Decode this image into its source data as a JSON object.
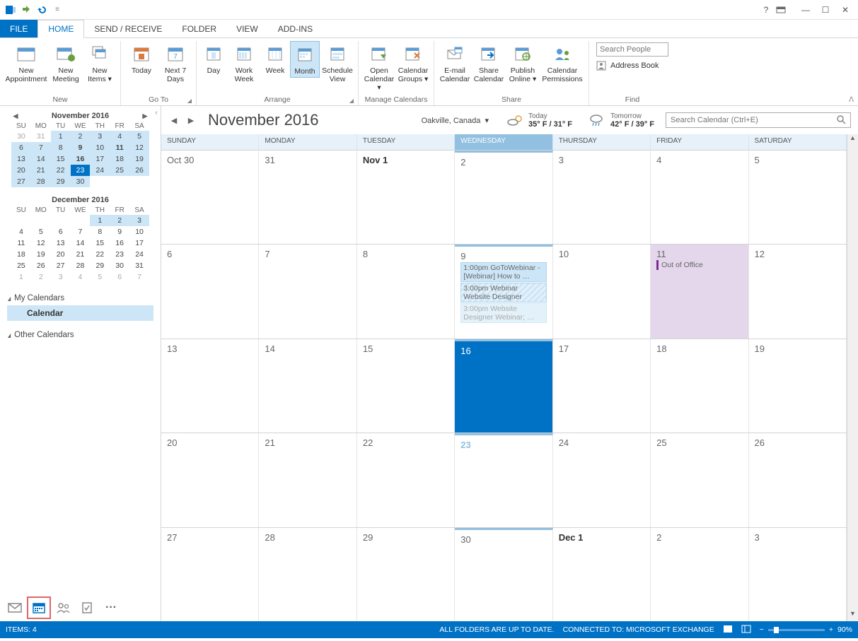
{
  "tabs": {
    "file": "FILE",
    "home": "HOME",
    "sendreceive": "SEND / RECEIVE",
    "folder": "FOLDER",
    "view": "VIEW",
    "addins": "ADD-INS"
  },
  "ribbon": {
    "new_appointment": "New\nAppointment",
    "new_meeting": "New\nMeeting",
    "new_items": "New\nItems ▾",
    "today": "Today",
    "next7": "Next 7\nDays",
    "day": "Day",
    "work_week": "Work\nWeek",
    "week": "Week",
    "month": "Month",
    "schedule_view": "Schedule\nView",
    "open_calendar": "Open\nCalendar ▾",
    "calendar_groups": "Calendar\nGroups ▾",
    "email_calendar": "E-mail\nCalendar",
    "share_calendar": "Share\nCalendar",
    "publish_online": "Publish\nOnline ▾",
    "calendar_permissions": "Calendar\nPermissions",
    "search_people_ph": "Search People",
    "address_book": "Address Book",
    "grp_new": "New",
    "grp_goto": "Go To",
    "grp_arrange": "Arrange",
    "grp_manage": "Manage Calendars",
    "grp_share": "Share",
    "grp_find": "Find"
  },
  "minical1": {
    "title": "November 2016",
    "dow": [
      "SU",
      "MO",
      "TU",
      "WE",
      "TH",
      "FR",
      "SA"
    ],
    "rows": [
      [
        {
          "d": "30",
          "c": "dim"
        },
        {
          "d": "31",
          "c": "dim"
        },
        {
          "d": "1",
          "c": "range"
        },
        {
          "d": "2",
          "c": "range"
        },
        {
          "d": "3",
          "c": "range"
        },
        {
          "d": "4",
          "c": "range"
        },
        {
          "d": "5",
          "c": "range"
        }
      ],
      [
        {
          "d": "6",
          "c": "range"
        },
        {
          "d": "7",
          "c": "range"
        },
        {
          "d": "8",
          "c": "range"
        },
        {
          "d": "9",
          "c": "range bold"
        },
        {
          "d": "10",
          "c": "range"
        },
        {
          "d": "11",
          "c": "range bold"
        },
        {
          "d": "12",
          "c": "range"
        }
      ],
      [
        {
          "d": "13",
          "c": "range"
        },
        {
          "d": "14",
          "c": "range"
        },
        {
          "d": "15",
          "c": "range"
        },
        {
          "d": "16",
          "c": "range bold"
        },
        {
          "d": "17",
          "c": "range"
        },
        {
          "d": "18",
          "c": "range"
        },
        {
          "d": "19",
          "c": "range"
        }
      ],
      [
        {
          "d": "20",
          "c": "range"
        },
        {
          "d": "21",
          "c": "range"
        },
        {
          "d": "22",
          "c": "range"
        },
        {
          "d": "23",
          "c": "today"
        },
        {
          "d": "24",
          "c": "range"
        },
        {
          "d": "25",
          "c": "range"
        },
        {
          "d": "26",
          "c": "range"
        }
      ],
      [
        {
          "d": "27",
          "c": "range"
        },
        {
          "d": "28",
          "c": "range"
        },
        {
          "d": "29",
          "c": "range"
        },
        {
          "d": "30",
          "c": "range"
        },
        {
          "d": "",
          "c": ""
        },
        {
          "d": "",
          "c": ""
        },
        {
          "d": "",
          "c": ""
        }
      ]
    ]
  },
  "minical2": {
    "title": "December 2016",
    "dow": [
      "SU",
      "MO",
      "TU",
      "WE",
      "TH",
      "FR",
      "SA"
    ],
    "rows": [
      [
        {
          "d": "",
          "c": ""
        },
        {
          "d": "",
          "c": ""
        },
        {
          "d": "",
          "c": ""
        },
        {
          "d": "",
          "c": ""
        },
        {
          "d": "1",
          "c": "range"
        },
        {
          "d": "2",
          "c": "range"
        },
        {
          "d": "3",
          "c": "range"
        }
      ],
      [
        {
          "d": "4",
          "c": ""
        },
        {
          "d": "5",
          "c": ""
        },
        {
          "d": "6",
          "c": ""
        },
        {
          "d": "7",
          "c": ""
        },
        {
          "d": "8",
          "c": ""
        },
        {
          "d": "9",
          "c": ""
        },
        {
          "d": "10",
          "c": ""
        }
      ],
      [
        {
          "d": "11",
          "c": ""
        },
        {
          "d": "12",
          "c": ""
        },
        {
          "d": "13",
          "c": ""
        },
        {
          "d": "14",
          "c": ""
        },
        {
          "d": "15",
          "c": ""
        },
        {
          "d": "16",
          "c": ""
        },
        {
          "d": "17",
          "c": ""
        }
      ],
      [
        {
          "d": "18",
          "c": ""
        },
        {
          "d": "19",
          "c": ""
        },
        {
          "d": "20",
          "c": ""
        },
        {
          "d": "21",
          "c": ""
        },
        {
          "d": "22",
          "c": ""
        },
        {
          "d": "23",
          "c": ""
        },
        {
          "d": "24",
          "c": ""
        }
      ],
      [
        {
          "d": "25",
          "c": ""
        },
        {
          "d": "26",
          "c": ""
        },
        {
          "d": "27",
          "c": ""
        },
        {
          "d": "28",
          "c": ""
        },
        {
          "d": "29",
          "c": ""
        },
        {
          "d": "30",
          "c": ""
        },
        {
          "d": "31",
          "c": ""
        }
      ],
      [
        {
          "d": "1",
          "c": "dim"
        },
        {
          "d": "2",
          "c": "dim"
        },
        {
          "d": "3",
          "c": "dim"
        },
        {
          "d": "4",
          "c": "dim"
        },
        {
          "d": "5",
          "c": "dim"
        },
        {
          "d": "6",
          "c": "dim"
        },
        {
          "d": "7",
          "c": "dim"
        }
      ]
    ]
  },
  "calgroups": {
    "my": "My Calendars",
    "calendar": "Calendar",
    "other": "Other Calendars"
  },
  "header": {
    "title": "November 2016",
    "location": "Oakville, Canada",
    "today_lbl": "Today",
    "today_tmp": "35° F / 31° F",
    "tomorrow_lbl": "Tomorrow",
    "tomorrow_tmp": "42° F / 39° F",
    "search_ph": "Search Calendar (Ctrl+E)"
  },
  "daynames": [
    "SUNDAY",
    "MONDAY",
    "TUESDAY",
    "WEDNESDAY",
    "THURSDAY",
    "FRIDAY",
    "SATURDAY"
  ],
  "weeks": [
    [
      {
        "n": "Oct 30"
      },
      {
        "n": "31"
      },
      {
        "n": "Nov 1",
        "b": 1
      },
      {
        "n": "2"
      },
      {
        "n": "3"
      },
      {
        "n": "4"
      },
      {
        "n": "5"
      }
    ],
    [
      {
        "n": "6"
      },
      {
        "n": "7"
      },
      {
        "n": "8"
      },
      {
        "n": "9",
        "ev": [
          {
            "t": "1:00pm GoToWebinar - [Webinar] How to …"
          },
          {
            "t": "3:00pm Webinar Website Designer",
            "c": "tent"
          },
          {
            "t": "3:00pm Website Designer Webinar; …",
            "c": "fade"
          }
        ]
      },
      {
        "n": "10"
      },
      {
        "n": "11",
        "purple": 1,
        "ev": [
          {
            "t": "Out of Office",
            "c": "oof"
          }
        ]
      },
      {
        "n": "12"
      }
    ],
    [
      {
        "n": "13"
      },
      {
        "n": "14"
      },
      {
        "n": "15"
      },
      {
        "n": "16",
        "sel": 1
      },
      {
        "n": "17"
      },
      {
        "n": "18"
      },
      {
        "n": "19"
      }
    ],
    [
      {
        "n": "20"
      },
      {
        "n": "21"
      },
      {
        "n": "22"
      },
      {
        "n": "23",
        "dim": 1
      },
      {
        "n": "24"
      },
      {
        "n": "25"
      },
      {
        "n": "26"
      }
    ],
    [
      {
        "n": "27"
      },
      {
        "n": "28"
      },
      {
        "n": "29"
      },
      {
        "n": "30"
      },
      {
        "n": "Dec 1",
        "b": 1
      },
      {
        "n": "2"
      },
      {
        "n": "3"
      }
    ]
  ],
  "status": {
    "items": "ITEMS: 4",
    "folders": "ALL FOLDERS ARE UP TO DATE.",
    "connected": "CONNECTED TO: MICROSOFT EXCHANGE",
    "zoom": "90%"
  }
}
